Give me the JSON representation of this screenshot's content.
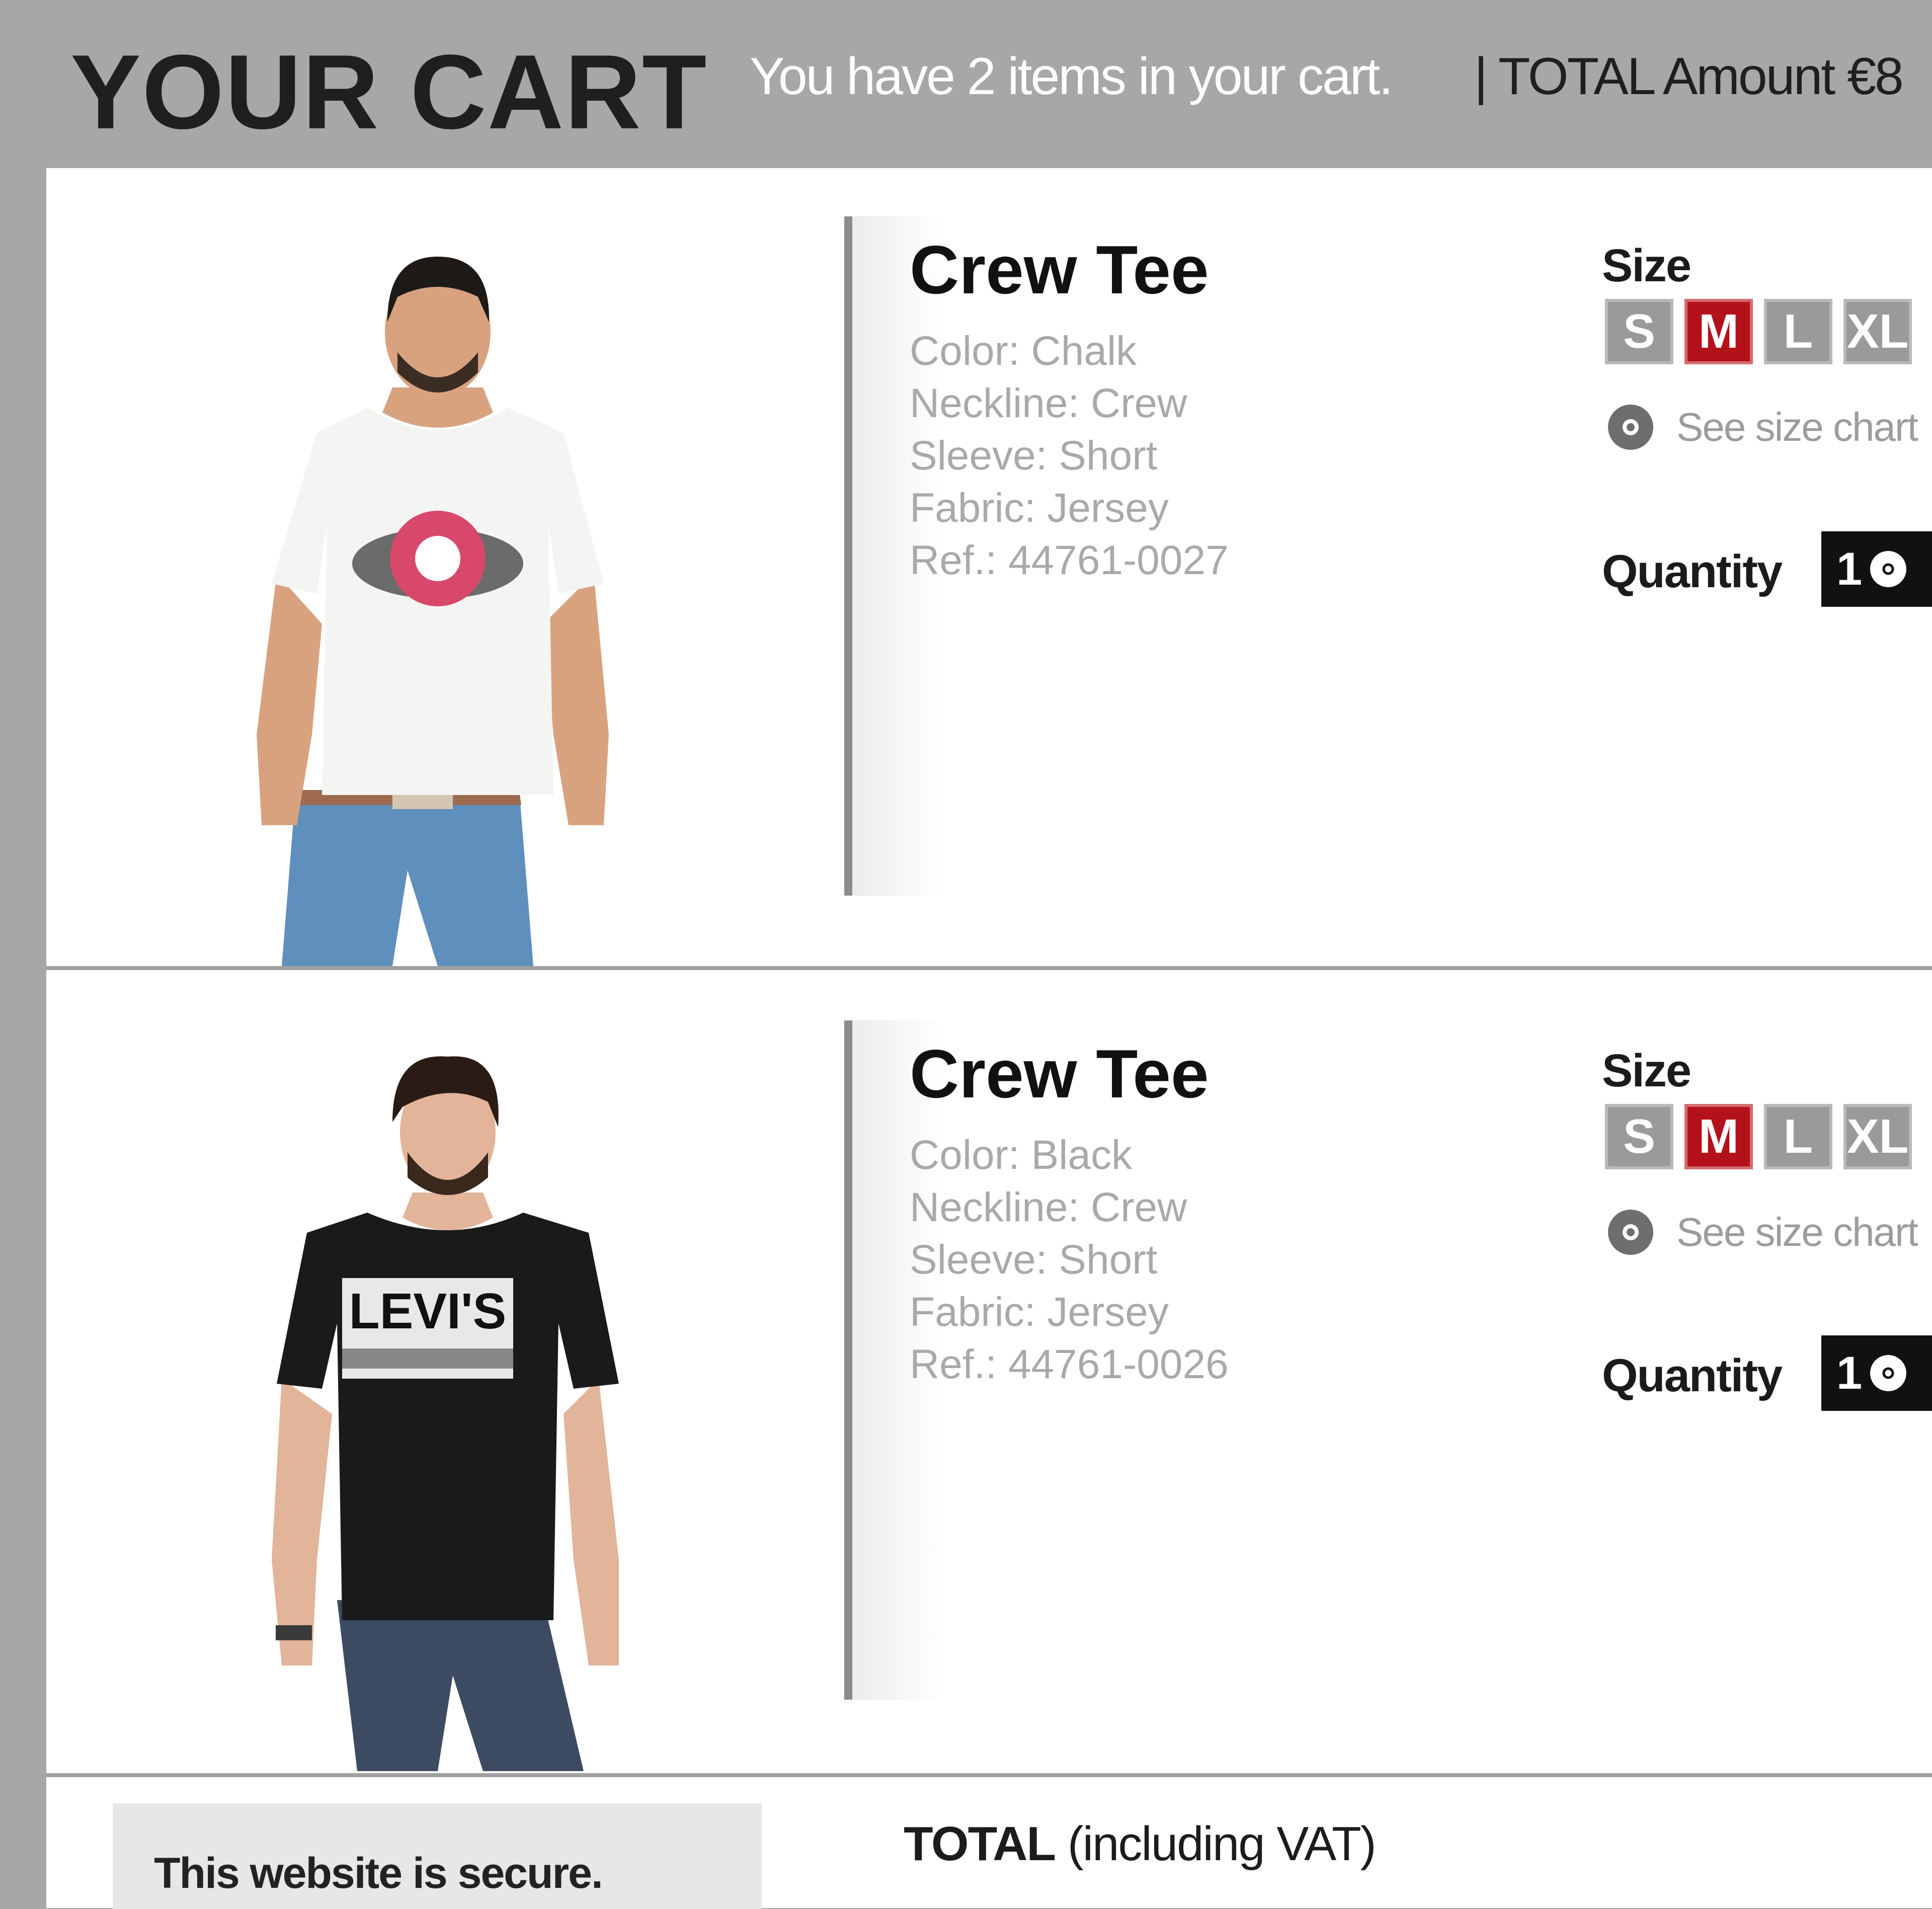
{
  "header": {
    "title": "YOUR CART",
    "count_text": "You have 2 items in your cart.",
    "total_text": "| TOTAL Amount €8"
  },
  "items": [
    {
      "name": "Crew Tee",
      "attrs": [
        "Color: Chalk",
        "Neckline: Crew",
        "Sleeve: Short",
        "Fabric: Jersey",
        "Ref.: 44761-0027"
      ],
      "shirt_color": "#f4f4f2",
      "size_label": "Size",
      "sizes": [
        "S",
        "M",
        "L",
        "XL"
      ],
      "selected_size": "M",
      "size_chart": "See size chart",
      "quantity_label": "Quantity",
      "quantity": "1"
    },
    {
      "name": "Crew Tee",
      "attrs": [
        "Color: Black",
        "Neckline: Crew",
        "Sleeve: Short",
        "Fabric: Jersey",
        "Ref.: 44761-0026"
      ],
      "shirt_color": "#1a1a1a",
      "print_text": "LEVI'S",
      "size_label": "Size",
      "sizes": [
        "S",
        "M",
        "L",
        "XL"
      ],
      "selected_size": "M",
      "size_chart": "See size chart",
      "quantity_label": "Quantity",
      "quantity": "1"
    }
  ],
  "footer": {
    "secure": "This website is secure.",
    "total_bold": "TOTAL",
    "total_rest": " (including VAT)"
  },
  "colors": {
    "background": "#a6a7a7",
    "selected_size": "#b4121b",
    "size_button": "#9a9a9a",
    "quantity_box": "#111111"
  }
}
